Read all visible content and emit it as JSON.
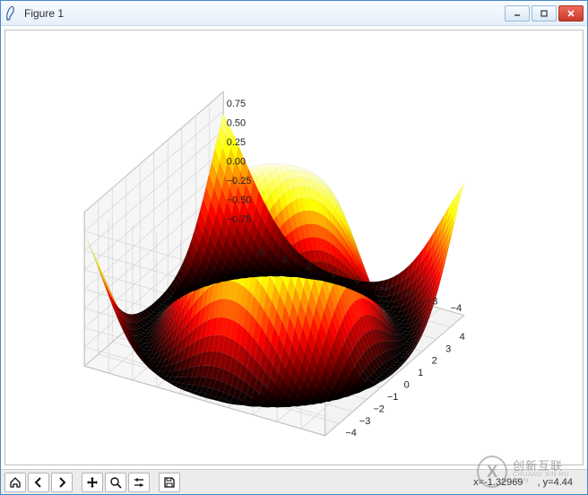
{
  "window": {
    "title": "Figure 1",
    "buttons": {
      "min": "minimize",
      "max": "maximize",
      "close": "close"
    }
  },
  "chart_data": {
    "type": "surface",
    "function": "z = sin(sqrt(x^2 + y^2))",
    "x_range": [
      -5,
      5
    ],
    "y_range": [
      -5,
      5
    ],
    "z_range": [
      -1,
      1
    ],
    "x_ticks": [
      -4,
      -3,
      -2,
      -1,
      0,
      1,
      2,
      3,
      4
    ],
    "y_ticks": [
      -4,
      -3,
      -2,
      -1,
      0,
      1,
      2,
      3,
      4
    ],
    "z_ticks": [
      -0.75,
      -0.5,
      -0.25,
      0.0,
      0.25,
      0.5,
      0.75
    ],
    "z_tick_labels": [
      "−0.75",
      "−0.50",
      "−0.25",
      "0.00",
      "0.25",
      "0.50",
      "0.75"
    ],
    "view": {
      "elev": 30,
      "azim": -60
    },
    "colormap": "hot",
    "grid": true,
    "wireframe_overlay": true
  },
  "toolbar": {
    "home": "Home",
    "back": "Back",
    "forward": "Forward",
    "pan": "Pan",
    "zoom": "Zoom",
    "configure": "Configure subplots",
    "save": "Save"
  },
  "status": {
    "x_label": "x=",
    "x_value": "-1.32969",
    "y_label": ", y=",
    "y_value": "4.44"
  },
  "watermark": {
    "logo_letter": "X",
    "cn": "创新互联",
    "en": "CHUANG XIN HU LIAN"
  }
}
